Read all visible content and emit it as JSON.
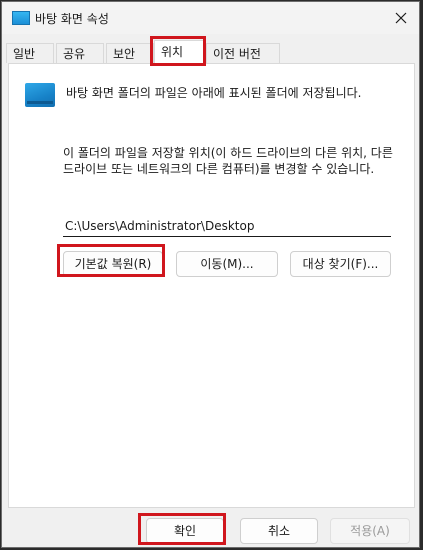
{
  "window": {
    "title": "바탕 화면 속성"
  },
  "tabs": [
    {
      "label": "일반"
    },
    {
      "label": "공유"
    },
    {
      "label": "보안"
    },
    {
      "label": "위치"
    },
    {
      "label": "이전 버전"
    }
  ],
  "panel": {
    "description": "바탕 화면 폴더의 파일은 아래에 표시된 폴더에 저장됩니다.",
    "instruction": "이 폴더의 파일을 저장할 위치(이 하드 드라이브의 다른 위치, 다른 드라이브 또는 네트워크의 다른 컴퓨터)를 변경할 수 있습니다.",
    "path_value": "C:\\Users\\Administrator\\Desktop",
    "restore_default_label": "기본값 복원(R)",
    "move_label": "이동(M)...",
    "find_target_label": "대상 찾기(F)..."
  },
  "footer": {
    "ok_label": "확인",
    "cancel_label": "취소",
    "apply_label": "적용(A)"
  },
  "colors": {
    "highlight": "#d0161d",
    "folder_icon": "#1c8fd6",
    "window_bg": "#f0f0f0",
    "panel_bg": "#ffffff"
  }
}
